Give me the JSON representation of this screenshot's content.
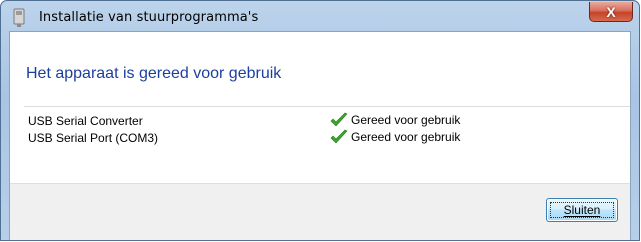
{
  "window": {
    "title": "Installatie van stuurprogramma's",
    "close_glyph": "X"
  },
  "main": {
    "heading": "Het apparaat is gereed voor gebruik",
    "devices": [
      {
        "name": "USB Serial Converter",
        "status": "Gereed voor gebruik",
        "status_icon": "green-check-icon"
      },
      {
        "name": "USB Serial Port (COM3)",
        "status": "Gereed voor gebruik",
        "status_icon": "green-check-icon"
      }
    ]
  },
  "footer": {
    "close_label": "Sluiten"
  },
  "colors": {
    "heading": "#1b3f9e",
    "check": "#3aa52b",
    "close_btn": "#c6432b"
  }
}
